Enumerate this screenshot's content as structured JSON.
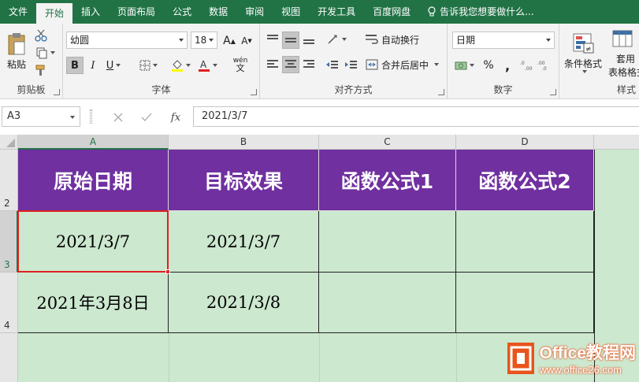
{
  "menu": {
    "tabs": [
      "文件",
      "开始",
      "插入",
      "页面布局",
      "公式",
      "数据",
      "审阅",
      "视图",
      "开发工具",
      "百度网盘"
    ],
    "tell_me": "告诉我您想要做什么..."
  },
  "ribbon": {
    "clipboard": {
      "paste": "粘贴",
      "label": "剪贴板"
    },
    "font": {
      "name": "幼圆",
      "size": "18",
      "bold": "B",
      "italic": "I",
      "underline": "U",
      "label": "字体",
      "grow": "A",
      "shrink": "A",
      "phonetic": "wén"
    },
    "alignment": {
      "wrap": "自动换行",
      "merge": "合并后居中",
      "label": "对齐方式"
    },
    "number": {
      "format": "日期",
      "percent": "%",
      "comma": ",",
      "label": "数字"
    },
    "styles": {
      "conditional": "条件格式",
      "table1": "套用",
      "table2": "表格格式",
      "label": "样式"
    }
  },
  "formula_bar": {
    "name_box": "A3",
    "fx": "fx",
    "value": "2021/3/7"
  },
  "grid": {
    "columns": [
      "A",
      "B",
      "C",
      "D"
    ],
    "rows": [
      "2",
      "3",
      "4"
    ],
    "headers": [
      "原始日期",
      "目标效果",
      "函数公式1",
      "函数公式2"
    ],
    "data": [
      [
        "2021/3/7",
        "2021/3/7",
        "",
        ""
      ],
      [
        "2021年3月8日",
        "2021/3/8",
        "",
        ""
      ]
    ],
    "selected_cell": "A3"
  },
  "colors": {
    "excel_green": "#217346",
    "header_purple": "#7030a0",
    "cell_bg": "#cce8cf",
    "selection_red": "#e02020"
  },
  "watermark": {
    "line1": "Office教程网",
    "line2": "www.office26.com"
  }
}
